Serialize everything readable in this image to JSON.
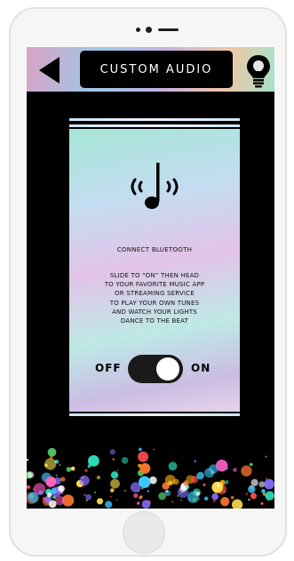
{
  "header": {
    "title": "CUSTOM AUDIO",
    "back_icon": "back-arrow-icon",
    "bulb_icon": "light-bulb-icon"
  },
  "card": {
    "icon": "music-note-bluetooth-icon",
    "heading": "CONNECT BLUETOOTH",
    "body_lines": [
      "SLIDE TO “ON” THEN HEAD",
      "TO YOUR FAVORITE MUSIC APP",
      "OR STREAMING SERVICE",
      "TO PLAY YOUR OWN TUNES",
      "AND WATCH YOUR LIGHTS",
      "DANCE TO THE BEAT"
    ]
  },
  "toggle": {
    "off_label": "OFF",
    "on_label": "ON",
    "state": "on"
  },
  "colors": {
    "screen_bg": "#000000",
    "knob": "#ffffff",
    "track": "#1a1a1a"
  }
}
